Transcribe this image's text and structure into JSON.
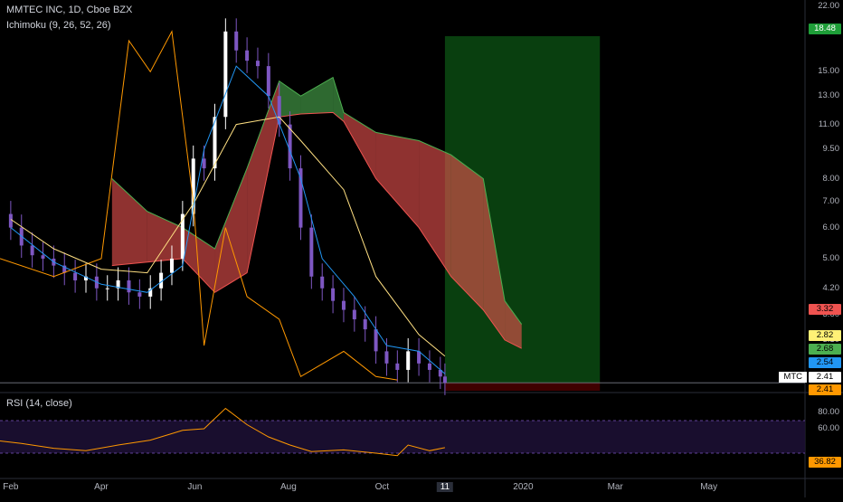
{
  "legend": {
    "title": "MMTEC INC, 1D, Cboe BZX",
    "ichimoku": "Ichimoku (9, 26, 52, 26)",
    "rsi": "RSI (14, close)"
  },
  "price_axis": [
    "22.00",
    "18.48",
    "15.00",
    "13.00",
    "11.00",
    "9.50",
    "8.00",
    "7.00",
    "6.00",
    "5.00",
    "4.20",
    "3.60",
    "3.10"
  ],
  "price_tags": [
    {
      "label": "18.48",
      "color": "#1e9e38"
    },
    {
      "label": "3.32",
      "color": "#ef5350"
    },
    {
      "label": "2.82",
      "color": "#fff176"
    },
    {
      "label": "2.68",
      "color": "#4caf50"
    },
    {
      "label": "2.54",
      "color": "#2196f3"
    },
    {
      "label": "2.41",
      "color": "#ffffff"
    },
    {
      "label": "2.41",
      "color": "#ff9800"
    }
  ],
  "symbol_tag": "MTC",
  "rsi_axis": [
    "80.00",
    "60.00"
  ],
  "rsi_tag": {
    "label": "36.82",
    "color": "#ff9800"
  },
  "time_axis": [
    "Feb",
    "Apr",
    "Jun",
    "Aug",
    "Oct",
    "11",
    "2020",
    "Mar",
    "May"
  ],
  "colors": {
    "conversion": "#2196f3",
    "base": "#ffe082",
    "lagging": "#ff9800",
    "cloud_bull": "#4caf50",
    "cloud_bear": "#ef5350",
    "candle_up": "#ffffff",
    "candle_down": "#7e57c2",
    "rsi": "#ff9800",
    "target_zone": "#0b4a12",
    "stop_zone": "#4a0000"
  },
  "chart_data": {
    "type": "candlestick",
    "title": "MMTEC INC, 1D, Cboe BZX",
    "indicators": [
      "Ichimoku (9, 26, 52, 26)",
      "RSI (14, close)"
    ],
    "price_scale": "log",
    "ylim": [
      2.3,
      22.5
    ],
    "time_range": [
      "2019-01-25",
      "2020-06-15"
    ],
    "last_price": 2.41,
    "close_series": [
      [
        "2019-01-25",
        6.5
      ],
      [
        "2019-02-01",
        6.0
      ],
      [
        "2019-02-08",
        5.4
      ],
      [
        "2019-02-15",
        5.1
      ],
      [
        "2019-02-22",
        5.0
      ],
      [
        "2019-03-01",
        4.8
      ],
      [
        "2019-03-08",
        4.6
      ],
      [
        "2019-03-15",
        4.4
      ],
      [
        "2019-03-22",
        4.5
      ],
      [
        "2019-03-29",
        4.2
      ],
      [
        "2019-04-05",
        4.2
      ],
      [
        "2019-04-12",
        4.4
      ],
      [
        "2019-04-19",
        4.1
      ],
      [
        "2019-04-26",
        4.0
      ],
      [
        "2019-05-03",
        4.2
      ],
      [
        "2019-05-10",
        4.6
      ],
      [
        "2019-05-17",
        5.0
      ],
      [
        "2019-05-24",
        6.5
      ],
      [
        "2019-05-31",
        9.0
      ],
      [
        "2019-06-07",
        8.5
      ],
      [
        "2019-06-14",
        11.5
      ],
      [
        "2019-06-21",
        19.0
      ],
      [
        "2019-06-28",
        17.0
      ],
      [
        "2019-07-05",
        16.0
      ],
      [
        "2019-07-12",
        15.5
      ],
      [
        "2019-07-19",
        13.0
      ],
      [
        "2019-07-26",
        11.0
      ],
      [
        "2019-08-02",
        8.5
      ],
      [
        "2019-08-09",
        6.0
      ],
      [
        "2019-08-16",
        4.5
      ],
      [
        "2019-08-23",
        4.2
      ],
      [
        "2019-08-30",
        3.9
      ],
      [
        "2019-09-06",
        3.7
      ],
      [
        "2019-09-13",
        3.5
      ],
      [
        "2019-09-20",
        3.3
      ],
      [
        "2019-09-27",
        2.9
      ],
      [
        "2019-10-04",
        2.7
      ],
      [
        "2019-10-11",
        2.6
      ],
      [
        "2019-10-18",
        2.9
      ],
      [
        "2019-10-25",
        2.7
      ],
      [
        "2019-11-01",
        2.6
      ],
      [
        "2019-11-08",
        2.5
      ],
      [
        "2019-11-11",
        2.41
      ]
    ],
    "ichimoku": {
      "conversion": [
        [
          "2019-02-01",
          6.0
        ],
        [
          "2019-03-01",
          4.9
        ],
        [
          "2019-04-01",
          4.3
        ],
        [
          "2019-05-01",
          4.1
        ],
        [
          "2019-05-24",
          4.8
        ],
        [
          "2019-06-07",
          9.5
        ],
        [
          "2019-06-28",
          15.5
        ],
        [
          "2019-07-19",
          13.0
        ],
        [
          "2019-08-09",
          8.0
        ],
        [
          "2019-08-23",
          5.0
        ],
        [
          "2019-09-13",
          4.0
        ],
        [
          "2019-10-04",
          3.0
        ],
        [
          "2019-10-25",
          2.9
        ],
        [
          "2019-11-11",
          2.54
        ]
      ],
      "base": [
        [
          "2019-02-01",
          6.3
        ],
        [
          "2019-03-01",
          5.3
        ],
        [
          "2019-04-01",
          4.7
        ],
        [
          "2019-05-01",
          4.6
        ],
        [
          "2019-06-01",
          7.0
        ],
        [
          "2019-06-28",
          11.0
        ],
        [
          "2019-07-26",
          11.5
        ],
        [
          "2019-08-09",
          10.0
        ],
        [
          "2019-09-06",
          7.5
        ],
        [
          "2019-09-27",
          4.5
        ],
        [
          "2019-10-25",
          3.2
        ],
        [
          "2019-11-11",
          2.82
        ]
      ],
      "lagging": [
        [
          "2019-01-25",
          5.0
        ],
        [
          "2019-03-01",
          4.5
        ],
        [
          "2019-04-01",
          5.0
        ],
        [
          "2019-04-19",
          18.0
        ],
        [
          "2019-05-03",
          15.0
        ],
        [
          "2019-05-17",
          19.0
        ],
        [
          "2019-05-31",
          7.0
        ],
        [
          "2019-06-07",
          3.0
        ],
        [
          "2019-06-21",
          6.0
        ],
        [
          "2019-07-05",
          4.0
        ],
        [
          "2019-07-26",
          3.5
        ],
        [
          "2019-08-09",
          2.5
        ],
        [
          "2019-09-06",
          2.9
        ],
        [
          "2019-09-27",
          2.5
        ],
        [
          "2019-10-11",
          2.45
        ]
      ],
      "cloud": [
        [
          "2019-04-08",
          8.0,
          4.8
        ],
        [
          "2019-05-01",
          6.6,
          4.9
        ],
        [
          "2019-05-24",
          6.0,
          5.0
        ],
        [
          "2019-06-14",
          5.3,
          4.1
        ],
        [
          "2019-07-05",
          8.5,
          4.6
        ],
        [
          "2019-07-26",
          14.2,
          11.5
        ],
        [
          "2019-08-09",
          13.0,
          11.7
        ],
        [
          "2019-08-30",
          14.5,
          11.8
        ],
        [
          "2019-09-06",
          11.8,
          11.2
        ],
        [
          "2019-09-27",
          10.5,
          8.0
        ],
        [
          "2019-10-25",
          10.0,
          6.0
        ],
        [
          "2019-11-15",
          9.2,
          4.5
        ],
        [
          "2019-12-06",
          8.0,
          3.7
        ],
        [
          "2019-12-20",
          3.9,
          3.1
        ],
        [
          "2019-12-31",
          3.4,
          2.95
        ]
      ]
    },
    "position": {
      "entry": 2.41,
      "target": 18.48,
      "stop": 2.15,
      "start": "2019-11-11",
      "end": "2020-02-20"
    },
    "rsi": {
      "ylim": [
        0,
        100
      ],
      "bands": [
        70,
        30
      ],
      "last": 36.82,
      "values": [
        [
          "2019-01-25",
          45
        ],
        [
          "2019-02-08",
          42
        ],
        [
          "2019-03-01",
          36
        ],
        [
          "2019-03-22",
          33
        ],
        [
          "2019-04-12",
          40
        ],
        [
          "2019-05-03",
          46
        ],
        [
          "2019-05-24",
          58
        ],
        [
          "2019-06-07",
          60
        ],
        [
          "2019-06-21",
          85
        ],
        [
          "2019-07-05",
          65
        ],
        [
          "2019-07-19",
          50
        ],
        [
          "2019-08-02",
          40
        ],
        [
          "2019-08-16",
          32
        ],
        [
          "2019-09-06",
          34
        ],
        [
          "2019-09-27",
          30
        ],
        [
          "2019-10-11",
          27
        ],
        [
          "2019-10-18",
          40
        ],
        [
          "2019-11-01",
          33
        ],
        [
          "2019-11-11",
          36.82
        ]
      ]
    }
  }
}
